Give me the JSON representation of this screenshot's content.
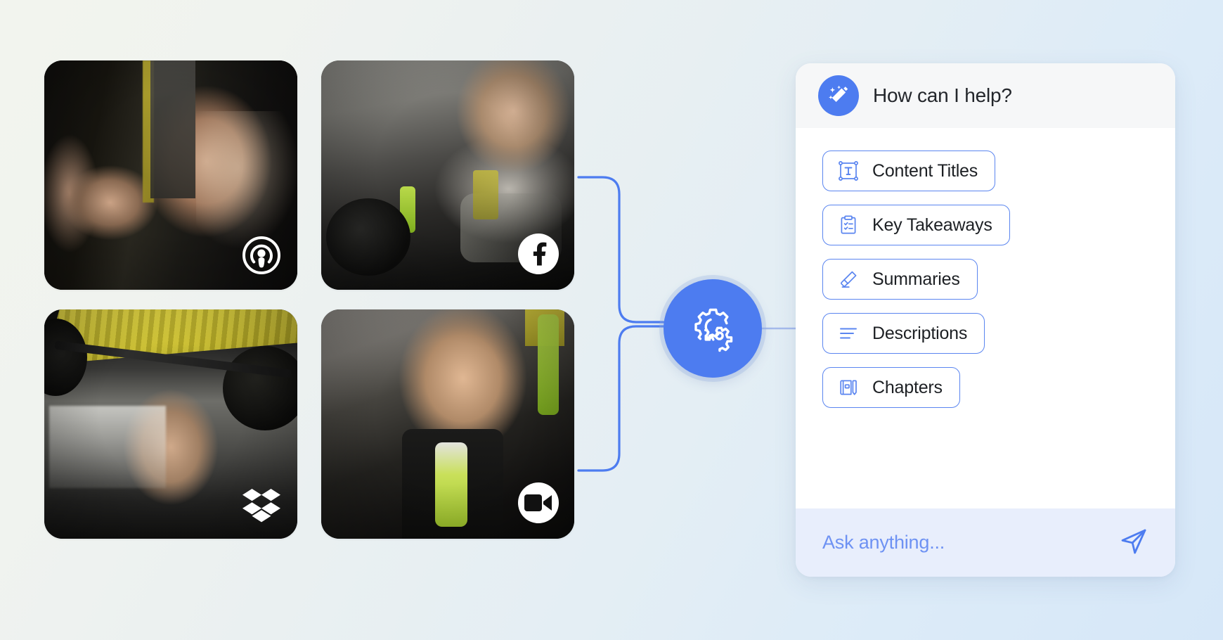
{
  "background": {
    "gradient_from": "#f2f4ee",
    "gradient_to": "#d6e7f8"
  },
  "accent": {
    "primary_blue": "#4d7cf0",
    "chip_border": "#5a85f0",
    "input_bg": "#e8eefc",
    "placeholder_blue": "#6e92f3"
  },
  "media_grid": {
    "items": [
      {
        "id": "thumb-1",
        "alt": "Two athletes high-fiving during plank in a dark gym",
        "badge_icon": "apple-podcasts-icon",
        "badge_label": "Apple Podcasts"
      },
      {
        "id": "thumb-2",
        "alt": "Woman with headphones sitting beside barbell in gym",
        "badge_icon": "facebook-icon",
        "badge_label": "Facebook"
      },
      {
        "id": "thumb-3",
        "alt": "Woman performing overhead barbell press under yellow ceiling",
        "badge_icon": "dropbox-icon",
        "badge_label": "Dropbox"
      },
      {
        "id": "thumb-4",
        "alt": "Smiling woman holding green water bottle against concrete wall",
        "badge_icon": "video-camera-icon",
        "badge_label": "Video"
      }
    ]
  },
  "hub": {
    "icon": "gears-icon",
    "label": "Processing hub"
  },
  "assistant_panel": {
    "header": {
      "icon": "magic-wand-icon",
      "title": "How can I help?"
    },
    "suggestions": [
      {
        "label": "Content Titles",
        "icon": "text-frame-icon"
      },
      {
        "label": "Key Takeaways",
        "icon": "clipboard-checklist-icon"
      },
      {
        "label": "Summaries",
        "icon": "highlighter-pen-icon"
      },
      {
        "label": "Descriptions",
        "icon": "text-lines-icon"
      },
      {
        "label": "Chapters",
        "icon": "book-icon"
      }
    ],
    "input": {
      "placeholder": "Ask anything...",
      "value": "",
      "send_icon": "send-paper-plane-icon"
    }
  }
}
